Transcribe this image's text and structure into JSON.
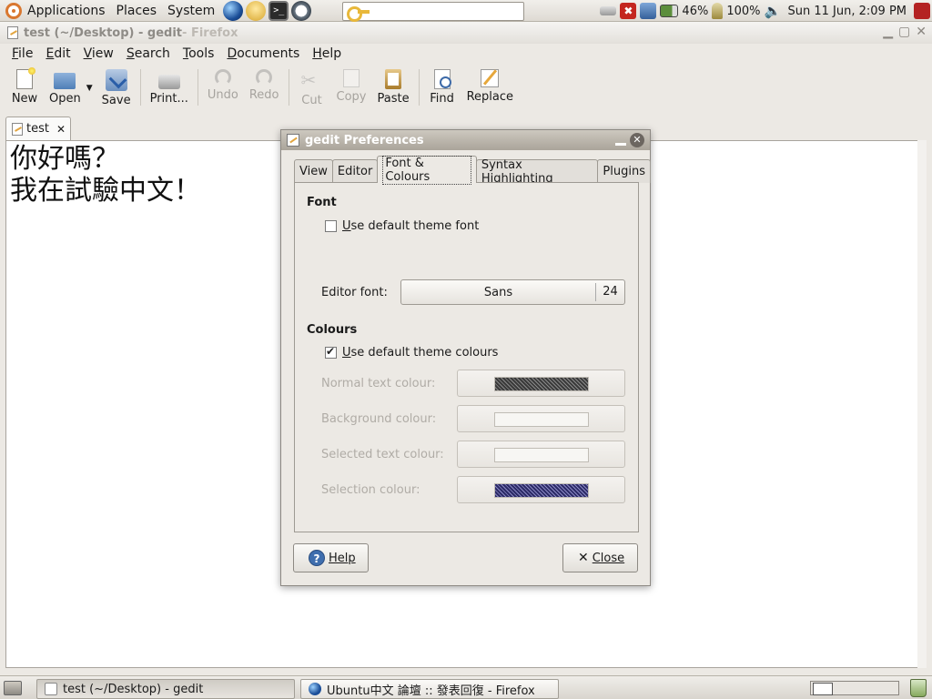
{
  "top_panel": {
    "menus": [
      "Applications",
      "Places",
      "System"
    ],
    "battery": "46%",
    "power": "100%",
    "clock": "Sun 11 Jun,  2:09 PM",
    "icons": [
      "ubuntu-logo-icon",
      "firefox-icon",
      "help-icon",
      "terminal-icon",
      "clock-app-icon",
      "drive-icon",
      "update-notifier-icon",
      "network-icon",
      "battery-icon",
      "power-plug-icon",
      "volume-icon",
      "logout-icon"
    ]
  },
  "gedit": {
    "title": "test (~/Desktop) - gedit",
    "title_suffix": " - Firefox",
    "menus": [
      "File",
      "Edit",
      "View",
      "Search",
      "Tools",
      "Documents",
      "Help"
    ],
    "toolbar": {
      "new": "New",
      "open": "Open",
      "save": "Save",
      "print": "Print...",
      "undo": "Undo",
      "redo": "Redo",
      "cut": "Cut",
      "copy": "Copy",
      "paste": "Paste",
      "find": "Find",
      "replace": "Replace"
    },
    "tab_label": "test",
    "lines": [
      "你好嗎？",
      "我在試驗中文！"
    ]
  },
  "prefs": {
    "title": "gedit Preferences",
    "tabs": [
      "View",
      "Editor",
      "Font & Colours",
      "Syntax Highlighting",
      "Plugins"
    ],
    "selected_tab": "Font & Colours",
    "font_section": "Font",
    "use_default_font_pre": "U",
    "use_default_font_rest": "se default theme font",
    "use_default_font_checked": false,
    "editor_font_label": "Editor font:",
    "editor_font_name": "Sans",
    "editor_font_size": "24",
    "colours_section": "Colours",
    "use_default_colours_pre": "U",
    "use_default_colours_rest": "se default theme colours",
    "use_default_colours_checked": true,
    "normal_text_colour": "Normal text colour:",
    "background_colour": "Background colour:",
    "selected_text_colour": "Selected text colour:",
    "selection_colour": "Selection colour:",
    "help_button": "Help",
    "close_button": "Close"
  },
  "bottom_panel": {
    "tasks": [
      "test (~/Desktop) - gedit",
      "Ubuntu中文 論壇 :: 發表回復 - Firefox"
    ]
  },
  "colors": {
    "normal_text": "#3a3a3a",
    "background": "#f7f6f3",
    "selected_text": "#f7f6f3",
    "selection": "#2b2a66"
  }
}
